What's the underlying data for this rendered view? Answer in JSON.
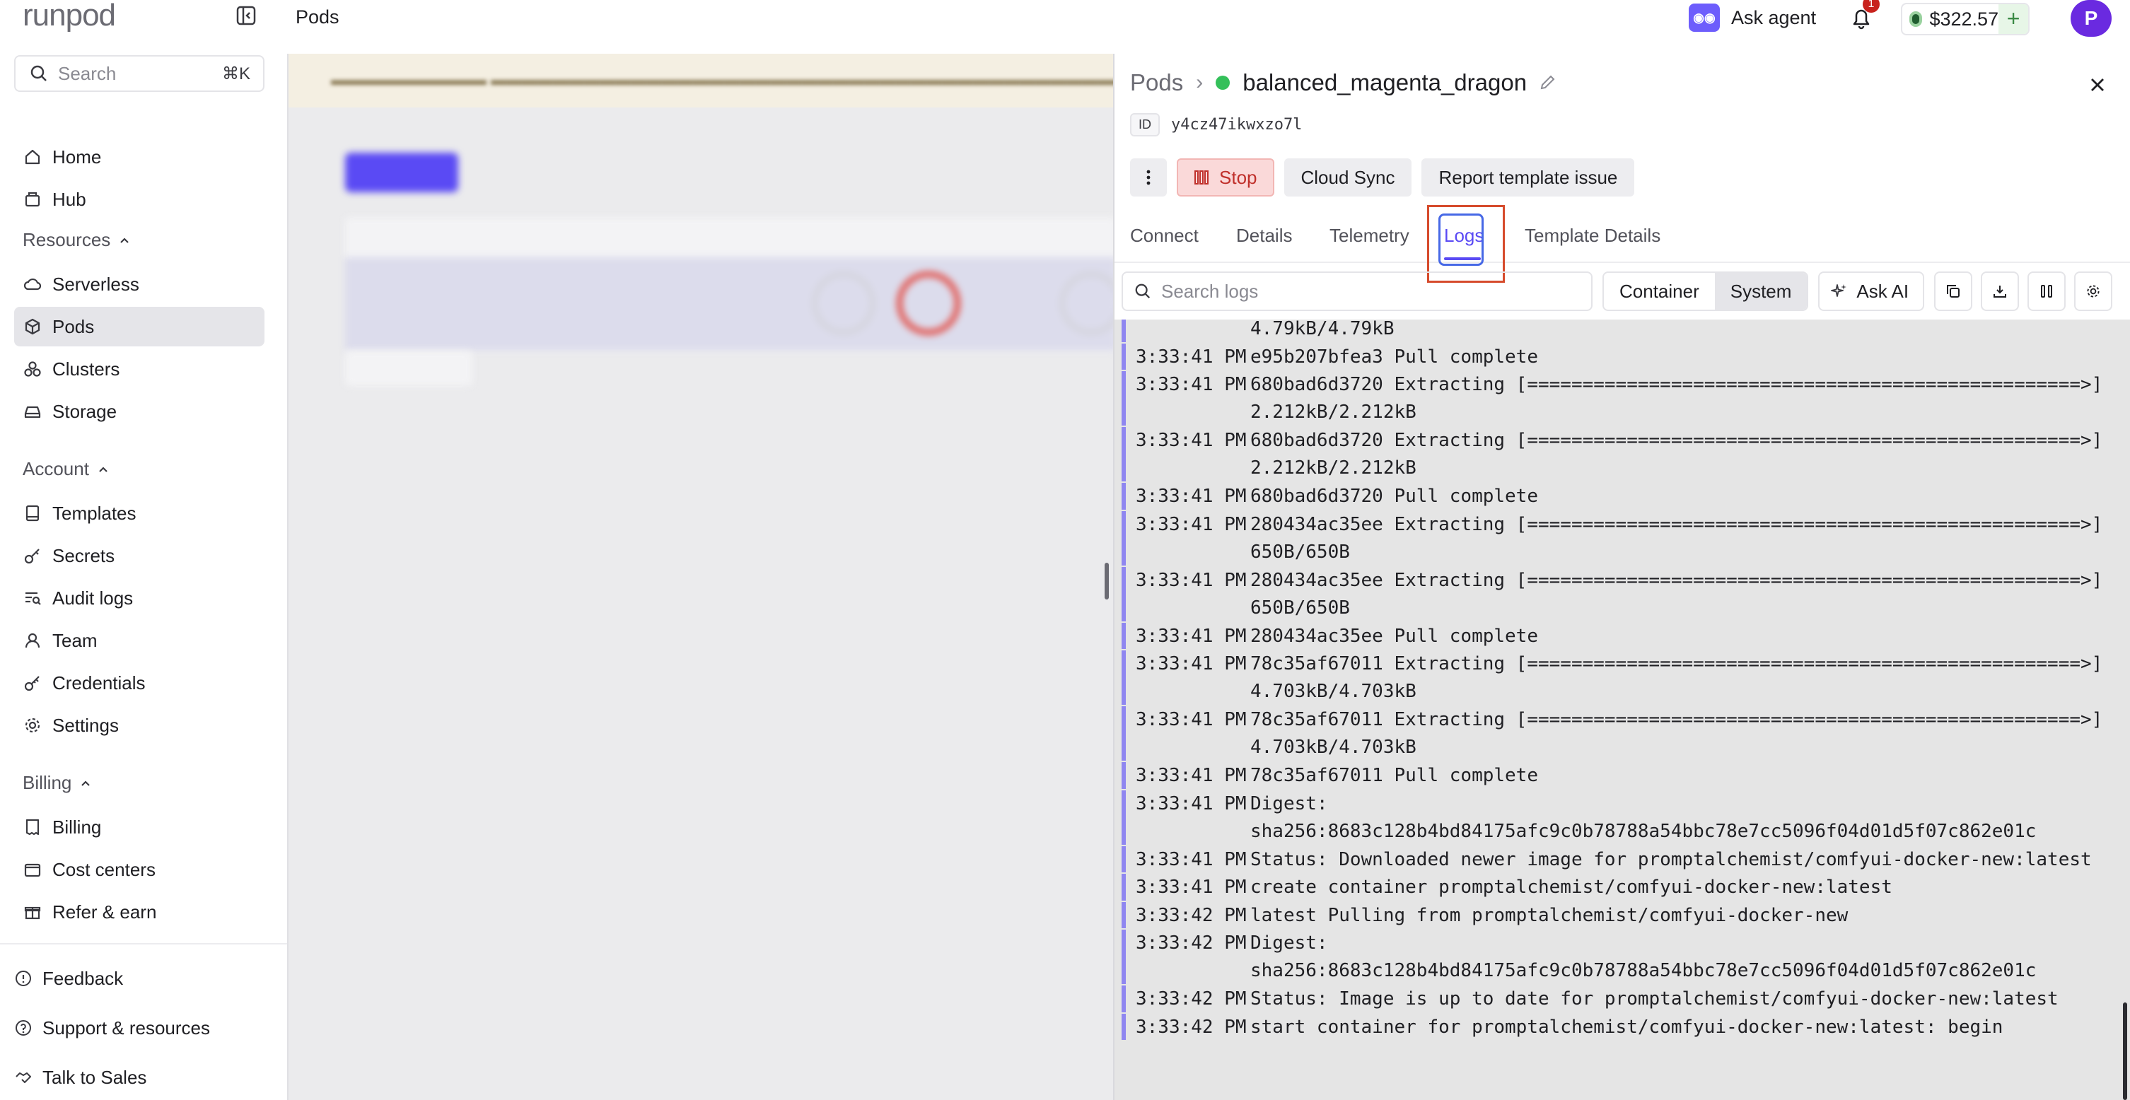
{
  "topbar": {
    "logo": "runpod",
    "page_title": "Pods",
    "ask_agent": "Ask agent",
    "notification_count": "1",
    "balance": "$322.57",
    "add_funds": "+",
    "avatar_initial": "P"
  },
  "sidebar": {
    "search_placeholder": "Search",
    "search_shortcut": "⌘K",
    "top_items": [
      {
        "label": "Home",
        "icon": "home-icon"
      },
      {
        "label": "Hub",
        "icon": "hub-icon"
      }
    ],
    "sections": [
      {
        "title": "Resources",
        "items": [
          {
            "label": "Serverless",
            "icon": "cloud-icon"
          },
          {
            "label": "Pods",
            "icon": "cube-icon",
            "active": true
          },
          {
            "label": "Clusters",
            "icon": "clusters-icon"
          },
          {
            "label": "Storage",
            "icon": "storage-icon"
          }
        ]
      },
      {
        "title": "Account",
        "items": [
          {
            "label": "Templates",
            "icon": "book-icon"
          },
          {
            "label": "Secrets",
            "icon": "key-icon"
          },
          {
            "label": "Audit logs",
            "icon": "audit-icon"
          },
          {
            "label": "Team",
            "icon": "user-icon"
          },
          {
            "label": "Credentials",
            "icon": "credentials-key-icon"
          },
          {
            "label": "Settings",
            "icon": "gear-icon"
          }
        ]
      },
      {
        "title": "Billing",
        "items": [
          {
            "label": "Billing",
            "icon": "receipt-icon"
          },
          {
            "label": "Cost centers",
            "icon": "wallet-icon"
          },
          {
            "label": "Refer & earn",
            "icon": "gift-icon"
          }
        ]
      }
    ],
    "footer": [
      {
        "label": "Feedback",
        "icon": "feedback-icon"
      },
      {
        "label": "Support & resources",
        "icon": "help-icon"
      },
      {
        "label": "Talk to Sales",
        "icon": "handshake-icon"
      }
    ]
  },
  "panel": {
    "breadcrumb_root": "Pods",
    "pod_name": "balanced_magenta_dragon",
    "id_label": "ID",
    "id_value": "y4cz47ikwxzo7l",
    "actions": {
      "stop": "Stop",
      "cloud_sync": "Cloud Sync",
      "report": "Report template issue"
    },
    "tabs": [
      "Connect",
      "Details",
      "Telemetry",
      "Logs",
      "Template Details"
    ],
    "active_tab": "Logs",
    "log_search_placeholder": "Search logs",
    "log_sources": [
      "Container",
      "System"
    ],
    "selected_source": "System",
    "ask_ai": "Ask AI",
    "status_color": "#34c05a",
    "accent_color": "#5a4af4"
  },
  "logs": [
    {
      "time": "",
      "lines": [
        "4.79kB/4.79kB"
      ]
    },
    {
      "time": "3:33:41 PM",
      "lines": [
        "e95b207bfea3 Pull complete"
      ]
    },
    {
      "time": "3:33:41 PM",
      "lines": [
        "680bad6d3720 Extracting [==================================================>]",
        "2.212kB/2.212kB"
      ]
    },
    {
      "time": "3:33:41 PM",
      "lines": [
        "680bad6d3720 Extracting [==================================================>]",
        "2.212kB/2.212kB"
      ]
    },
    {
      "time": "3:33:41 PM",
      "lines": [
        "680bad6d3720 Pull complete"
      ]
    },
    {
      "time": "3:33:41 PM",
      "lines": [
        "280434ac35ee Extracting [==================================================>]",
        "650B/650B"
      ]
    },
    {
      "time": "3:33:41 PM",
      "lines": [
        "280434ac35ee Extracting [==================================================>]",
        "650B/650B"
      ]
    },
    {
      "time": "3:33:41 PM",
      "lines": [
        "280434ac35ee Pull complete"
      ]
    },
    {
      "time": "3:33:41 PM",
      "lines": [
        "78c35af67011 Extracting [==================================================>]",
        "4.703kB/4.703kB"
      ]
    },
    {
      "time": "3:33:41 PM",
      "lines": [
        "78c35af67011 Extracting [==================================================>]",
        "4.703kB/4.703kB"
      ]
    },
    {
      "time": "3:33:41 PM",
      "lines": [
        "78c35af67011 Pull complete"
      ]
    },
    {
      "time": "3:33:41 PM",
      "lines": [
        "Digest:",
        "sha256:8683c128b4bd84175afc9c0b78788a54bbc78e7cc5096f04d01d5f07c862e01c"
      ]
    },
    {
      "time": "3:33:41 PM",
      "lines": [
        "Status: Downloaded newer image for promptalchemist/comfyui-docker-new:latest"
      ]
    },
    {
      "time": "3:33:41 PM",
      "lines": [
        "create container promptalchemist/comfyui-docker-new:latest"
      ]
    },
    {
      "time": "3:33:42 PM",
      "lines": [
        "latest Pulling from promptalchemist/comfyui-docker-new"
      ]
    },
    {
      "time": "3:33:42 PM",
      "lines": [
        "Digest:",
        "sha256:8683c128b4bd84175afc9c0b78788a54bbc78e7cc5096f04d01d5f07c862e01c"
      ]
    },
    {
      "time": "3:33:42 PM",
      "lines": [
        "Status: Image is up to date for promptalchemist/comfyui-docker-new:latest"
      ]
    },
    {
      "time": "3:33:42 PM",
      "lines": [
        "start container for promptalchemist/comfyui-docker-new:latest: begin"
      ]
    }
  ]
}
